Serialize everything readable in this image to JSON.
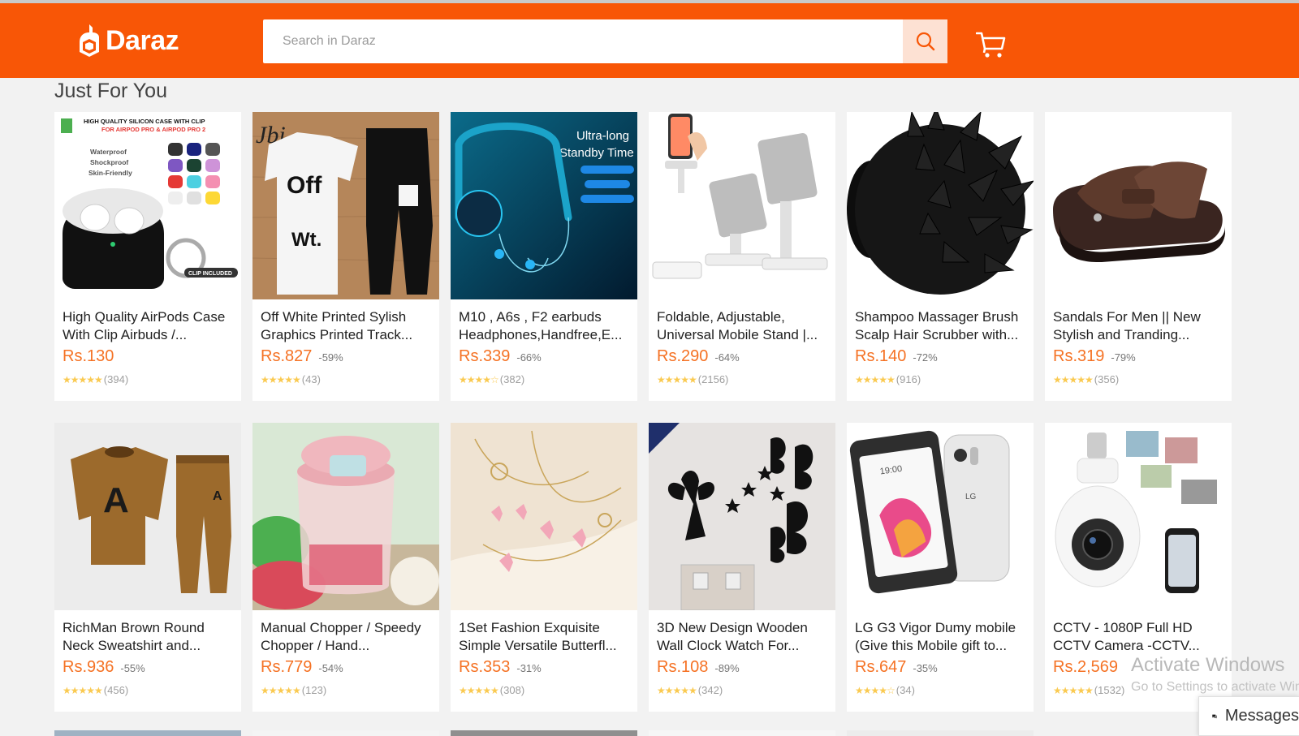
{
  "header": {
    "logo_text": "Daraz",
    "search_placeholder": "Search in Daraz",
    "brand_color": "#f85606",
    "icons": [
      "daraz-logo-icon",
      "search-icon",
      "cart-icon"
    ]
  },
  "section": {
    "title": "Just For You"
  },
  "products": [
    {
      "name": "High Quality AirPods Case With Clip Airbuds /...",
      "price": "Rs.130",
      "discount": "",
      "stars": "★★★★★",
      "reviews": "(394)",
      "image": "airpods-case",
      "image_text": {
        "l1": "HIGH QUALITY SILICON CASE WITH CLIP",
        "l2": "FOR AIRPOD PRO & AIRPOD PRO 2",
        "l3": "Waterproof",
        "l4": "Shockproof",
        "l5": "Skin-Friendly",
        "l6": "CLIP INCLUDED"
      }
    },
    {
      "name": "Off White Printed Sylish Graphics Printed Track...",
      "price": "Rs.827",
      "discount": "-59%",
      "stars": "★★★★★",
      "reviews": "(43)",
      "image": "tracksuit",
      "image_text": {
        "brand": "Jbi",
        "print": "Off",
        "print2": "Wt."
      }
    },
    {
      "name": "M10 , A6s , F2 earbuds Headphones,Handfree,E...",
      "price": "Rs.339",
      "discount": "-66%",
      "stars": "★★★★☆",
      "reviews": "(382)",
      "image": "neckband",
      "image_text": {
        "l1": "Ultra-long",
        "l2": "Standby Time"
      }
    },
    {
      "name": "Foldable, Adjustable, Universal Mobile Stand |...",
      "price": "Rs.290",
      "discount": "-64%",
      "stars": "★★★★★",
      "reviews": "(2156)",
      "image": "phone-stand"
    },
    {
      "name": "Shampoo Massager Brush Scalp Hair Scrubber with...",
      "price": "Rs.140",
      "discount": "-72%",
      "stars": "★★★★★",
      "reviews": "(916)",
      "image": "scalp-brush"
    },
    {
      "name": "Sandals For Men || New Stylish and Tranding...",
      "price": "Rs.319",
      "discount": "-79%",
      "stars": "★★★★★",
      "reviews": "(356)",
      "image": "sandal"
    },
    {
      "name": "RichMan Brown Round Neck Sweatshirt and...",
      "price": "Rs.936",
      "discount": "-55%",
      "stars": "★★★★★",
      "reviews": "(456)",
      "image": "sweatshirt"
    },
    {
      "name": "Manual Chopper / Speedy Chopper / Hand...",
      "price": "Rs.779",
      "discount": "-54%",
      "stars": "★★★★★",
      "reviews": "(123)",
      "image": "chopper"
    },
    {
      "name": "1Set Fashion Exquisite Simple Versatile Butterfl...",
      "price": "Rs.353",
      "discount": "-31%",
      "stars": "★★★★★",
      "reviews": "(308)",
      "image": "jewelry"
    },
    {
      "name": "3D New Design Wooden Wall Clock Watch For...",
      "price": "Rs.108",
      "discount": "-89%",
      "stars": "★★★★★",
      "reviews": "(342)",
      "image": "wall-decal"
    },
    {
      "name": "LG G3 Vigor Dumy mobile (Give this Mobile gift to...",
      "price": "Rs.647",
      "discount": "-35%",
      "stars": "★★★★☆",
      "reviews": "(34)",
      "image": "lg-phone",
      "image_text": {
        "time": "19:00",
        "brand": "LG"
      }
    },
    {
      "name": "CCTV - 1080P Full HD CCTV Camera -CCTV...",
      "price": "Rs.2,569",
      "discount": "",
      "stars": "★★★★★",
      "reviews": "(1532)",
      "image": "cctv"
    }
  ],
  "overlay": {
    "watermark_title": "Activate Windows",
    "watermark_sub": "Go to Settings to activate Windows.",
    "message_label": "Messages"
  }
}
